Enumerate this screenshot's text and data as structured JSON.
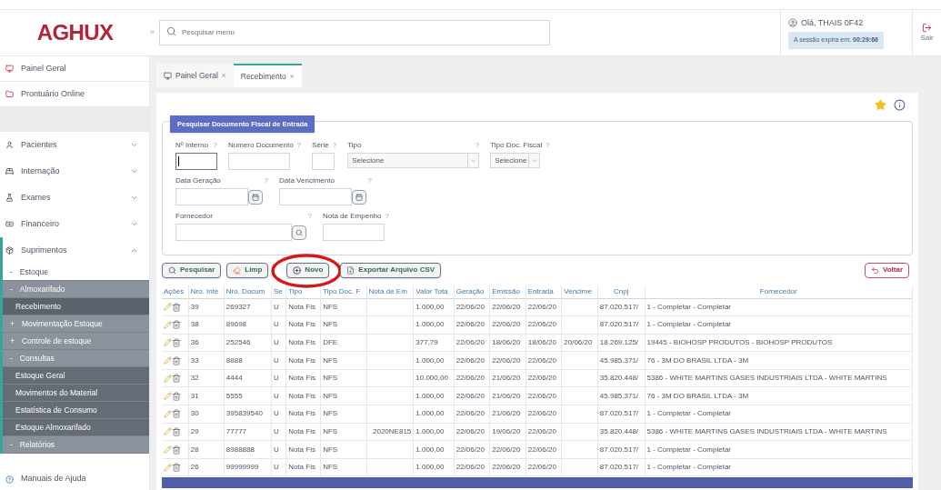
{
  "header": {
    "logo": "AGHUX",
    "collapse": "«",
    "search": {
      "placeholder": "Pesquisar menu"
    },
    "user": "Olá, THAIS 0F42",
    "session": "A sessão expira em: **00:29:66**",
    "logout": "Sair"
  },
  "sidebar": {
    "top_items": [
      {
        "label": "Painel Geral"
      },
      {
        "label": "Prontuário Online"
      }
    ],
    "menu": [
      {
        "label": "Pacientes",
        "expanded": false
      },
      {
        "label": "Internação",
        "expanded": false
      },
      {
        "label": "Exames",
        "expanded": false
      },
      {
        "label": "Financeiro",
        "expanded": false
      },
      {
        "label": "Suprimentos",
        "expanded": true,
        "children": [
          {
            "sign": "-",
            "label": "Estoque",
            "children": [
              {
                "sign": "-",
                "label": "Almoxarifado",
                "children": [
                  {
                    "label": "Recebimento",
                    "selected": true
                  },
                  {
                    "sign": "+",
                    "label": "Movimentação Estoque"
                  },
                  {
                    "sign": "+",
                    "label": "Controle de estoque"
                  },
                  {
                    "sign": "-",
                    "label": "Consultas",
                    "children": [
                      {
                        "label": "Estoque Geral",
                        "selected": false
                      },
                      {
                        "label": "Movimentos do Material",
                        "selected": false
                      },
                      {
                        "label": "Estatística de Consumo",
                        "selected": false
                      },
                      {
                        "label": "Estoque Almoxarifado",
                        "selected": false
                      }
                    ]
                  },
                  {
                    "sign": "-",
                    "label": "Relatórios"
                  }
                ]
              }
            ]
          }
        ]
      }
    ],
    "help": "Manuais de Ajuda"
  },
  "tabs": [
    {
      "label": "Painel Geral",
      "close": "×",
      "selected": false
    },
    {
      "label": "Recebimento",
      "close": "×",
      "selected": true
    }
  ],
  "form": {
    "legend": "Pesquisar Documento Fiscal de Entrada",
    "rows": [
      [
        {
          "kind": "text",
          "label": "Nº Interno",
          "help": "?",
          "focused": true
        },
        {
          "kind": "text",
          "label": "Número Documento",
          "help": "?",
          "focused": false
        },
        {
          "kind": "text",
          "label": "Série",
          "help": "?",
          "focused": false
        },
        {
          "kind": "select",
          "label": "Tipo",
          "help": "?",
          "value": "Selecione",
          "wide": true
        },
        {
          "kind": "select",
          "label": "Tipo Doc. Fiscal",
          "help": "?",
          "value": "Selecione",
          "wide": false
        }
      ],
      [
        {
          "kind": "date",
          "label": "Data Geração",
          "help": "?"
        },
        {
          "kind": "date",
          "label": "Data Vencimento",
          "help": "?"
        }
      ],
      [
        {
          "kind": "lookup",
          "label": "Fornecedor",
          "help": "?"
        },
        {
          "kind": "text",
          "label": "Nota de Empenho",
          "help": "?",
          "focused": false
        }
      ]
    ]
  },
  "actions": [
    {
      "kind": "search",
      "label": "Pesquisar"
    },
    {
      "kind": "clear",
      "label": "Limp"
    },
    {
      "kind": "new",
      "label": "Novo",
      "circled": true
    },
    {
      "kind": "export",
      "label": "Exportar Arquivo CSV"
    }
  ],
  "back": "Voltar",
  "table": {
    "columns": [
      "Ações",
      "Nro. Inte",
      "Nro. Docum",
      "Se",
      "Tipo",
      "Tipo Doc. F",
      "Nota de Em",
      "Valor Tota",
      "Geração",
      "Emissão",
      "Entrada",
      "Vencime",
      "Cnpj",
      "Fornecedor"
    ],
    "rows": [
      [
        "",
        "39",
        "269327",
        "U",
        "Nota Fis",
        "NFS",
        "",
        "1.000,00",
        "22/06/20",
        "22/06/20",
        "22/06/20",
        "",
        "87.020.517/",
        "1 - Completar - Completar"
      ],
      [
        "",
        "38",
        "89698",
        "U",
        "Nota Fis",
        "NFS",
        "",
        "1.000,00",
        "22/06/20",
        "22/06/20",
        "22/06/20",
        "",
        "87.020.517/",
        "1 - Completar - Completar"
      ],
      [
        "",
        "36",
        "252546",
        "U",
        "Nota Fis",
        "DFE",
        "",
        "377,79",
        "22/06/20",
        "18/06/20",
        "18/06/20",
        "20/06/20",
        "18.269.125/",
        "19445 - BIOHOSP PRODUTOS - BIOHOSP PRODUTOS"
      ],
      [
        "",
        "33",
        "8888",
        "U",
        "Nota Fis",
        "NFS",
        "",
        "1.000,00",
        "22/06/20",
        "22/06/20",
        "22/06/20",
        "",
        "45.985.371/",
        "76 - 3M DO BRASIL LTDA - 3M"
      ],
      [
        "",
        "32",
        "4444",
        "U",
        "Nota Fis",
        "NFS",
        "",
        "10.000,00",
        "22/06/20",
        "21/06/20",
        "22/06/20",
        "",
        "35.820.448/",
        "5386 - WHITE MARTINS GASES INDUSTRIAIS LTDA - WHITE MARTINS"
      ],
      [
        "",
        "31",
        "5555",
        "U",
        "Nota Fis",
        "NFS",
        "",
        "1.000,00",
        "22/06/20",
        "21/06/20",
        "22/06/20",
        "",
        "45.985.371/",
        "76 - 3M DO BRASIL LTDA - 3M"
      ],
      [
        "",
        "30",
        "395839540",
        "U",
        "Nota Fis",
        "NFS",
        "",
        "1.000,00",
        "22/06/20",
        "21/06/20",
        "22/06/20",
        "",
        "87.020.517/",
        "1 - Completar - Completar"
      ],
      [
        "",
        "29",
        "77777",
        "U",
        "Nota Fis",
        "NFS",
        "2020NE815",
        "1.000,00",
        "22/06/20",
        "19/06/20",
        "22/06/20",
        "",
        "35.820.448/",
        "5386 - WHITE MARTINS GASES INDUSTRIAIS LTDA - WHITE MARTINS"
      ],
      [
        "",
        "28",
        "8988888",
        "U",
        "Nota Fis",
        "NFS",
        "",
        "1.000,00",
        "22/06/20",
        "22/06/20",
        "22/06/20",
        "",
        "87.020.517/",
        "1 - Completar - Completar"
      ],
      [
        "",
        "26",
        "99999999",
        "U",
        "Nota Fis",
        "NFS",
        "",
        "1.000,00",
        "22/06/20",
        "22/06/20",
        "22/06/20",
        "",
        "87.020.517/",
        "1 - Completar - Completar"
      ]
    ]
  }
}
